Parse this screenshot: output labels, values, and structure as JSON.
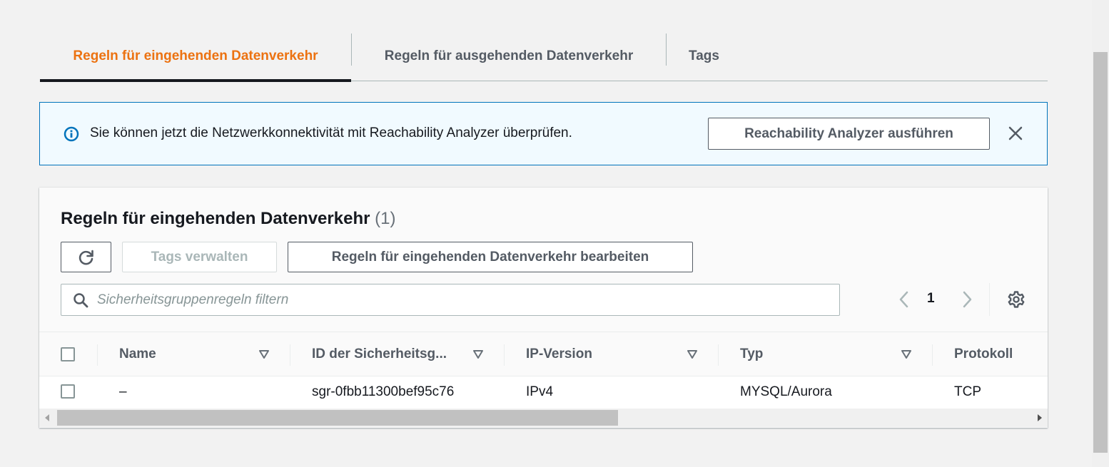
{
  "tabs": [
    {
      "label": "Regeln für eingehenden Datenverkehr",
      "active": true
    },
    {
      "label": "Regeln für ausgehenden Datenverkehr",
      "active": false
    },
    {
      "label": "Tags",
      "active": false
    }
  ],
  "banner": {
    "message": "Sie können jetzt die Netzwerkkonnektivität mit Reachability Analyzer überprüfen.",
    "action_label": "Reachability Analyzer ausführen",
    "icon": "info-icon",
    "close_icon": "close-icon"
  },
  "panel": {
    "title": "Regeln für eingehenden Datenverkehr",
    "count": "(1)",
    "refresh_icon": "refresh-icon",
    "manage_tags_label": "Tags verwalten",
    "edit_rules_label": "Regeln für eingehenden Datenverkehr bearbeiten",
    "search_placeholder": "Sicherheitsgruppenregeln filtern",
    "search_value": "",
    "pagination": {
      "current_page": "1"
    }
  },
  "table": {
    "columns": [
      "Name",
      "ID der Sicherheitsg...",
      "IP-Version",
      "Typ",
      "Protokoll"
    ],
    "rows": [
      {
        "name": "–",
        "id": "sgr-0fbb11300bef95c76",
        "ip_version": "IPv4",
        "type": "MYSQL/Aurora",
        "protocol": "TCP"
      }
    ]
  },
  "colors": {
    "accent_orange": "#ec7211",
    "info_blue": "#0073bb",
    "banner_bg": "#f1faff",
    "text_dark": "#16191f",
    "text_gray": "#545b64"
  }
}
